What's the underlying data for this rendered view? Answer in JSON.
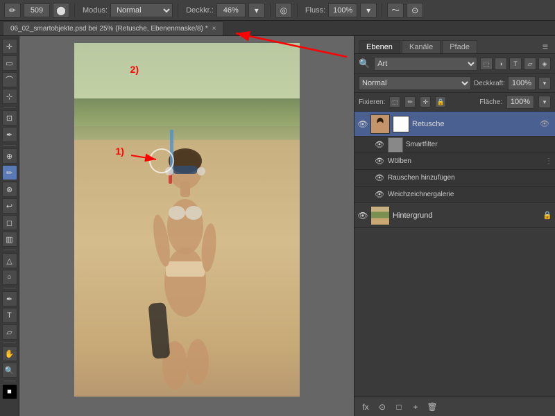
{
  "toolbar": {
    "brush_size": "509",
    "mode_label": "Modus:",
    "mode_value": "Normal",
    "opacity_label": "Deckkr.:",
    "opacity_value": "46%",
    "flow_label": "Fluss:",
    "flow_value": "100%"
  },
  "tab": {
    "filename": "06_02_smartobjekte.psd bei 25% (Retusche, Ebenenmaske/8) *",
    "close": "×"
  },
  "annotations": {
    "label_1": "1)",
    "label_2": "2)"
  },
  "right_panel": {
    "tabs": [
      "Ebenen",
      "Kanäle",
      "Pfade"
    ],
    "active_tab": "Ebenen",
    "filter_placeholder": "Art",
    "blend_mode": "Normal",
    "opacity_label": "Deckkraft:",
    "opacity_value": "100%",
    "lock_label": "Fixieren:",
    "fill_label": "Fläche:",
    "fill_value": "100%",
    "layers": [
      {
        "name": "Retusche",
        "visible": true,
        "active": true,
        "has_mask": true,
        "smart_filters": [
          {
            "name": "Smartfilter",
            "visible": true,
            "type": "group"
          },
          {
            "name": "Wölben",
            "visible": true
          },
          {
            "name": "Rauschen hinzufügen",
            "visible": true
          },
          {
            "name": "Weichzeichnergalerie",
            "visible": true
          }
        ]
      },
      {
        "name": "Hintergrund",
        "visible": true,
        "active": false,
        "locked": true
      }
    ],
    "bottom_buttons": [
      "fx",
      "⊙",
      "↺",
      "🗑"
    ]
  }
}
